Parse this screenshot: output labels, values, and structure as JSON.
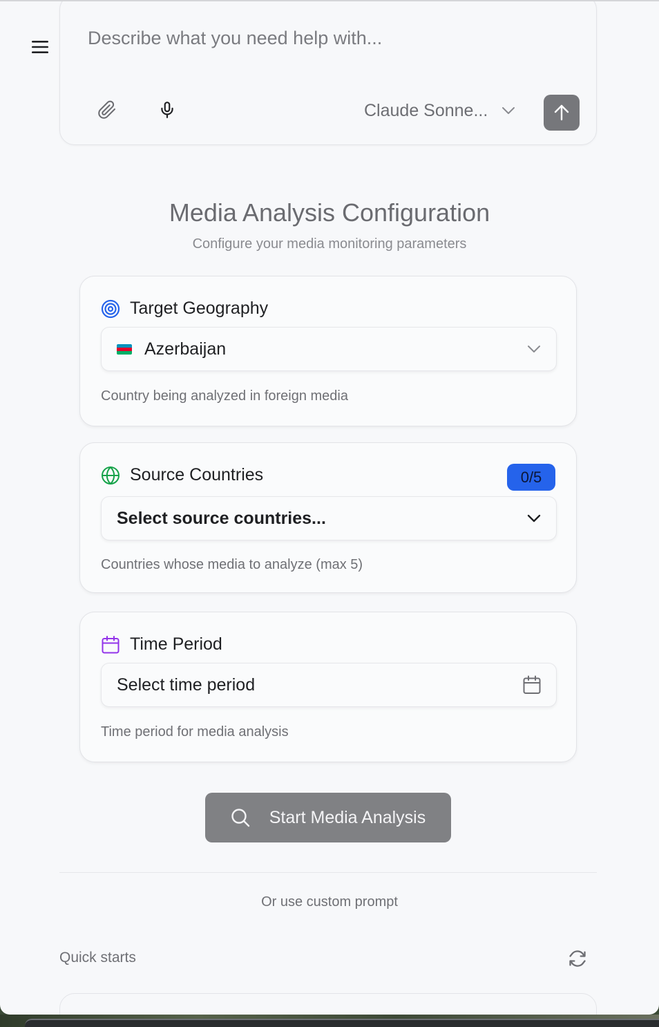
{
  "prompt": {
    "placeholder": "Describe what you need help with...",
    "model_label": "Claude Sonne..."
  },
  "config": {
    "title": "Media Analysis Configuration",
    "subtitle": "Configure your media monitoring parameters"
  },
  "target_geography": {
    "title": "Target Geography",
    "value": "Azerbaijan",
    "helper": "Country being analyzed in foreign media",
    "icon": "target-icon",
    "flag_colors": [
      "#0092bc",
      "#e4002b",
      "#00af66"
    ]
  },
  "source_countries": {
    "title": "Source Countries",
    "count_badge": "0/5",
    "value": "Select source countries...",
    "helper": "Countries whose media to analyze (max 5)",
    "icon": "globe-icon"
  },
  "time_period": {
    "title": "Time Period",
    "value": "Select time period",
    "helper": "Time period for media analysis",
    "icon": "calendar-icon"
  },
  "actions": {
    "start_label": "Start Media Analysis",
    "custom_prompt_label": "Or use custom prompt"
  },
  "quick_starts": {
    "label": "Quick starts"
  },
  "colors": {
    "accent_blue": "#2563eb",
    "globe_green": "#16a34a",
    "calendar_purple": "#9333ea"
  }
}
